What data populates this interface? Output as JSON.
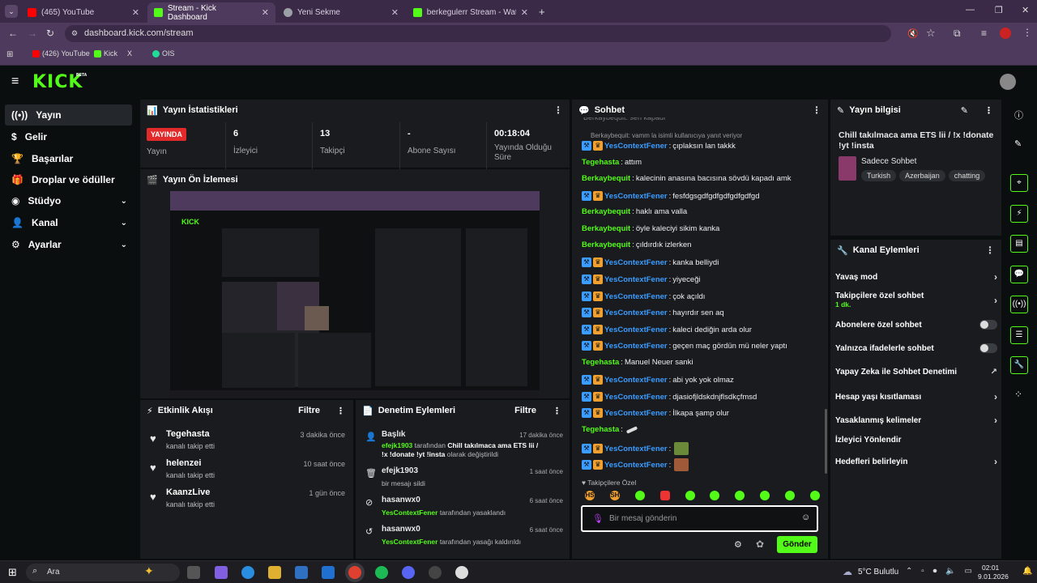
{
  "browser": {
    "tabs": [
      {
        "label": "(465) YouTube",
        "color": "#ff0000"
      },
      {
        "label": "Stream - Kick Dashboard",
        "color": "#53fc18"
      },
      {
        "label": "Yeni Sekme",
        "color": "#9aa0a6"
      },
      {
        "label": "berkegulerr Stream - Watch Liv",
        "color": "#53fc18"
      }
    ],
    "url": "dashboard.kick.com/stream",
    "bookmarks": [
      "(426) YouTube",
      "Kick",
      "X",
      "OIS"
    ]
  },
  "kick": {
    "logo": "KICK",
    "beta": "BETA"
  },
  "sidebar": {
    "items": [
      {
        "label": "Yayın",
        "icon": "broadcast-icon"
      },
      {
        "label": "Gelir",
        "icon": "dollar-icon"
      },
      {
        "label": "Başarılar",
        "icon": "trophy-icon"
      },
      {
        "label": "Droplar ve ödüller",
        "icon": "gift-icon"
      },
      {
        "label": "Stüdyo",
        "icon": "studio-icon"
      },
      {
        "label": "Kanal",
        "icon": "user-icon"
      },
      {
        "label": "Ayarlar",
        "icon": "gear-icon"
      }
    ]
  },
  "stats": {
    "title": "Yayın İstatistikleri",
    "live_badge": "YAYINDA",
    "live_label": "Yayın",
    "items": [
      {
        "value": "6",
        "label": "İzleyici"
      },
      {
        "value": "13",
        "label": "Takipçi"
      },
      {
        "value": "-",
        "label": "Abone Sayısı"
      },
      {
        "value": "00:18:04",
        "label": "Yayında Olduğu Süre"
      }
    ]
  },
  "preview": {
    "title": "Yayın Ön İzlemesi"
  },
  "activity": {
    "title": "Etkinlik Akışı",
    "filter": "Filtre",
    "items": [
      {
        "name": "Tegehasta",
        "sub": "kanalı takip etti",
        "time": "3 dakika önce"
      },
      {
        "name": "helenzei",
        "sub": "kanalı takip etti",
        "time": "10 saat önce"
      },
      {
        "name": "KaanzLive",
        "sub": "kanalı takip etti",
        "time": "1 gün önce"
      }
    ]
  },
  "moderation": {
    "title": "Denetim Eylemleri",
    "filter": "Filtre",
    "items": [
      {
        "name": "Başlık",
        "user": "efejk1903",
        "mid": " tarafından ",
        "bold": "Chill takılmaca ama ETS lii / !x !donate !yt !insta",
        "end": " olarak değiştirildi",
        "time": "17 dakika önce"
      },
      {
        "name": "efejk1903",
        "user": "",
        "mid": "bir mesajı sildi",
        "bold": "",
        "end": "",
        "time": "1 saat önce"
      },
      {
        "name": "hasanwx0",
        "user": "YesContextFener",
        "mid": " tarafından yasaklandı",
        "bold": "",
        "end": "",
        "time": "6 saat önce"
      },
      {
        "name": "hasanwx0",
        "user": "YesContextFener",
        "mid": " tarafından yasağı kaldırıldı",
        "bold": "",
        "end": "",
        "time": "6 saat önce"
      }
    ]
  },
  "chat": {
    "title": "Sohbet",
    "top_cut": "Berkaybequit: sen kapadi",
    "reply": "Berkaybequit: vamm la isimli kullanıcıya yanıt veriyor",
    "messages": [
      {
        "user": "YesContextFener",
        "text": "çıplaksın lan takkk",
        "badges": true
      },
      {
        "user": "Tegehasta",
        "text": "attım",
        "badges": false
      },
      {
        "user": "Berkaybequit",
        "text": "kalecinin anasına bacısına sövdü kapadı amk",
        "badges": false
      },
      {
        "user": "YesContextFener",
        "text": "fesfdgsgdfgdfgdfgdfgdfgd",
        "badges": true
      },
      {
        "user": "Berkaybequit",
        "text": "haklı ama valla",
        "badges": false
      },
      {
        "user": "Berkaybequit",
        "text": "öyle kaleciyi sikim kanka",
        "badges": false
      },
      {
        "user": "Berkaybequit",
        "text": "çıldırdık izlerken",
        "badges": false
      },
      {
        "user": "YesContextFener",
        "text": "kanka belliydi",
        "badges": true
      },
      {
        "user": "YesContextFener",
        "text": "yiyeceği",
        "badges": true
      },
      {
        "user": "YesContextFener",
        "text": "çok açıldı",
        "badges": true
      },
      {
        "user": "YesContextFener",
        "text": "hayırdır sen aq",
        "badges": true
      },
      {
        "user": "YesContextFener",
        "text": "kaleci dediğin arda olur",
        "badges": true
      },
      {
        "user": "YesContextFener",
        "text": "geçen maç gördün mü neler yaptı",
        "badges": true
      },
      {
        "user": "Tegehasta",
        "text": "Manuel Neuer sanki",
        "badges": false
      },
      {
        "user": "YesContextFener",
        "text": "abi yok yok olmaz",
        "badges": true
      },
      {
        "user": "YesContextFener",
        "text": "djasiofjldskdnjflsdkçfmsd",
        "badges": true
      },
      {
        "user": "YesContextFener",
        "text": "İlkapa şamp olur",
        "badges": true
      },
      {
        "user": "Tegehasta",
        "text": "",
        "badges": false
      },
      {
        "user": "YesContextFener",
        "text": "",
        "badges": true
      },
      {
        "user": "YesContextFener",
        "text": "",
        "badges": true
      }
    ],
    "followers_only": "Takipçilere Özel",
    "placeholder": "Bir mesaj gönderin",
    "send": "Gönder"
  },
  "info": {
    "title": "Yayın bilgisi",
    "stream_title": "Chill takılmaca ama ETS lii / !x !donate !yt !insta",
    "category": "Sadece Sohbet",
    "tags": [
      "Turkish",
      "Azerbaijan",
      "chatting"
    ]
  },
  "channel_actions": {
    "title": "Kanal Eylemleri",
    "items": [
      {
        "label": "Yavaş mod",
        "sub": "",
        "type": "arrow"
      },
      {
        "label": "Takipçilere özel sohbet",
        "sub": "1 dk.",
        "type": "arrow"
      },
      {
        "label": "Abonelere özel sohbet",
        "sub": "",
        "type": "toggle"
      },
      {
        "label": "Yalnızca ifadelerle sohbet",
        "sub": "",
        "type": "toggle"
      },
      {
        "label": "Yapay Zeka ile Sohbet Denetimi",
        "sub": "",
        "type": "external"
      },
      {
        "label": "Hesap yaşı kısıtlaması",
        "sub": "",
        "type": "arrow"
      },
      {
        "label": "Yasaklanmış kelimeler",
        "sub": "",
        "type": "arrow"
      },
      {
        "label": "İzleyici Yönlendir",
        "sub": "",
        "type": "none"
      },
      {
        "label": "Hedefleri belirleyin",
        "sub": "",
        "type": "arrow"
      }
    ]
  },
  "taskbar": {
    "search": "Ara",
    "weather": "5°C Bulutlu",
    "time": "02:01",
    "date": "9.01.2026"
  },
  "colors": {
    "accent": "#53fc18",
    "live": "#e22a2a",
    "blue_user": "#3a9dff"
  }
}
